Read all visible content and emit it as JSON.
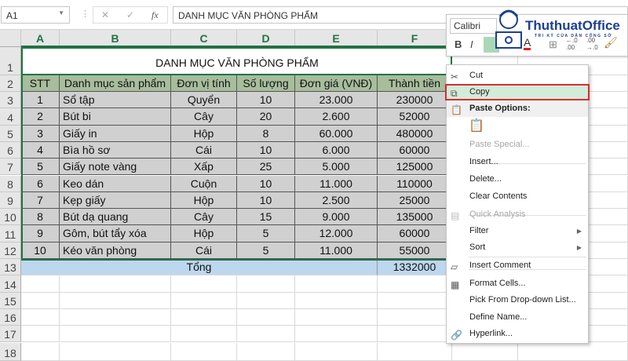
{
  "formula_bar": {
    "name_box": "A1",
    "cancel_icon": "✕",
    "enter_icon": "✓",
    "fx_label": "fx",
    "content": "DANH MỤC VĂN PHÒNG PHẨM"
  },
  "columns": [
    "A",
    "B",
    "C",
    "D",
    "E",
    "F"
  ],
  "row_numbers": [
    "1",
    "2",
    "3",
    "4",
    "5",
    "6",
    "7",
    "8",
    "9",
    "10",
    "11",
    "12",
    "13",
    "14",
    "15",
    "16",
    "17",
    "18"
  ],
  "sheet": {
    "title": "DANH MỤC VĂN PHÒNG PHẨM",
    "headers": [
      "STT",
      "Danh mục sản phẩm",
      "Đơn vị tính",
      "Số lượng",
      "Đơn giá (VNĐ)",
      "Thành tiền"
    ],
    "rows": [
      [
        "1",
        "Sổ tập",
        "Quyển",
        "10",
        "23.000",
        "230000"
      ],
      [
        "2",
        "Bút bi",
        "Cây",
        "20",
        "2.600",
        "52000"
      ],
      [
        "3",
        "Giấy in",
        "Hộp",
        "8",
        "60.000",
        "480000"
      ],
      [
        "4",
        "Bìa hồ sơ",
        "Cái",
        "10",
        "6.000",
        "60000"
      ],
      [
        "5",
        "Giấy note vàng",
        "Xấp",
        "25",
        "5.000",
        "125000"
      ],
      [
        "6",
        "Keo dán",
        "Cuộn",
        "10",
        "11.000",
        "110000"
      ],
      [
        "7",
        "Kẹp giấy",
        "Hộp",
        "10",
        "2.500",
        "25000"
      ],
      [
        "8",
        "Bút dạ quang",
        "Cây",
        "15",
        "9.000",
        "135000"
      ],
      [
        "9",
        "Gôm, bút tẩy xóa",
        "Hộp",
        "5",
        "12.000",
        "60000"
      ],
      [
        "10",
        "Kéo văn phòng",
        "Cái",
        "5",
        "11.000",
        "55000"
      ]
    ],
    "total_label": "Tổng",
    "total_value": "1332000"
  },
  "colors": {
    "header_fill": "#a7bd9c",
    "data_fill": "#d0d0d0",
    "total_fill": "#bdd7ee",
    "copy_highlight": "#d3ebd9",
    "copy_border": "#d32f2f",
    "accent": "#217346"
  },
  "mini_toolbar": {
    "font": "Calibri",
    "bold": "B",
    "italic": "I",
    "logo_text": "ThuthuatOffice",
    "logo_tagline": "TRI KỶ CỦA DÂN CÔNG SỞ"
  },
  "context_menu": {
    "items": [
      {
        "label": "Cut",
        "icon": "scissors-icon",
        "glyph": "✂"
      },
      {
        "label": "Copy",
        "icon": "copy-icon",
        "glyph": "⧉"
      },
      {
        "label": "Paste Options:",
        "icon": "paste-icon",
        "glyph": "📋"
      },
      {
        "label": "Paste Special...",
        "disabled": true
      },
      {
        "label": "Insert..."
      },
      {
        "label": "Delete..."
      },
      {
        "label": "Clear Contents"
      },
      {
        "label": "Quick Analysis",
        "icon": "quick-analysis-icon",
        "glyph": "▤",
        "disabled": true
      },
      {
        "label": "Filter",
        "submenu": true
      },
      {
        "label": "Sort",
        "submenu": true
      },
      {
        "label": "Insert Comment",
        "icon": "comment-icon",
        "glyph": "▱"
      },
      {
        "label": "Format Cells...",
        "icon": "format-cells-icon",
        "glyph": "▦"
      },
      {
        "label": "Pick From Drop-down List..."
      },
      {
        "label": "Define Name..."
      },
      {
        "label": "Hyperlink...",
        "icon": "hyperlink-icon",
        "glyph": "🔗"
      }
    ]
  }
}
